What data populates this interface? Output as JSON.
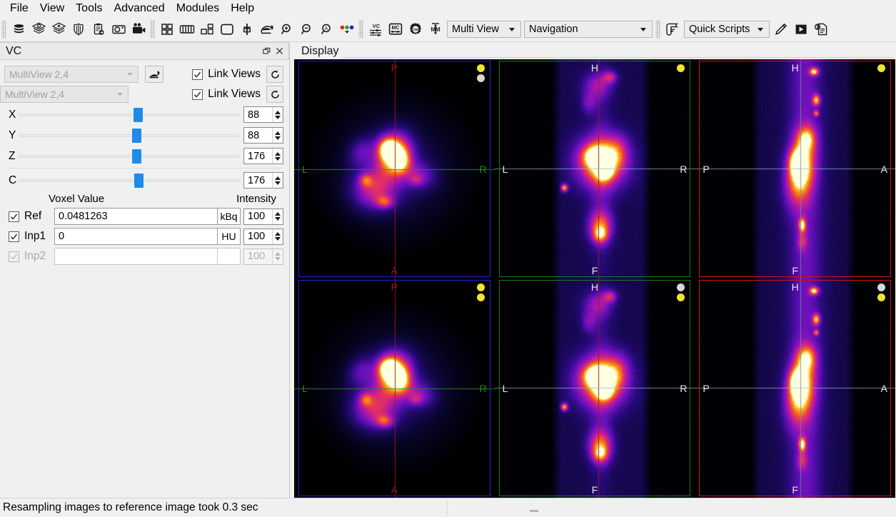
{
  "menubar": {
    "items": [
      {
        "label": "File"
      },
      {
        "label": "View"
      },
      {
        "label": "Tools"
      },
      {
        "label": "Advanced"
      },
      {
        "label": "Modules"
      },
      {
        "label": "Help"
      }
    ]
  },
  "toolbar": {
    "group1_icons": [
      "database-icon",
      "layers-one-icon",
      "layers-plus-icon",
      "shield-icon",
      "clipboard-export-icon",
      "camera-icon",
      "video-camera-icon"
    ],
    "group2_icons": [
      "grid-four-icon",
      "multi-slice-icon",
      "layout-mixed-icon",
      "single-view-icon",
      "fusion-icon",
      "pan-hand-icon",
      "zoom-in-icon",
      "zoom-out-icon",
      "zoom-region-icon",
      "rgb-channels-icon"
    ],
    "group3_icons": [
      "vc-icon",
      "mc-icon",
      "dm-icon",
      "mm-icon"
    ],
    "view_mode": {
      "value": "Multi View",
      "name": "view-mode-select"
    },
    "interaction_mode": {
      "value": "Navigation",
      "name": "interaction-mode-select"
    },
    "script_icon": "script-scroll-icon",
    "scripts": {
      "value": "Quick Scripts",
      "name": "quick-scripts-select"
    },
    "edit_script_icon": "pencil-icon",
    "run_script_icon": "play-icon",
    "script_log_icon": "script-document-icon"
  },
  "vc_panel": {
    "title": "VC",
    "float_icon": "float-window-icon",
    "close_icon": "close-icon",
    "combo1": {
      "value": "MultiView 2,4"
    },
    "combo2": {
      "value": "MultiView 2,4"
    },
    "blend_icon": "blend-layers-icon",
    "link1": {
      "label": "Link Views",
      "checked": true
    },
    "link2": {
      "label": "Link Views",
      "checked": true
    },
    "reset1_icon": "reset-circular-arrow-icon",
    "reset2_icon": "reset-circular-arrow-icon",
    "sliders": [
      {
        "label": "X",
        "value": "88",
        "pos_pct": 52
      },
      {
        "label": "Y",
        "value": "88",
        "pos_pct": 52
      },
      {
        "label": "Z",
        "value": "176",
        "pos_pct": 52
      },
      {
        "label": "C",
        "value": "176",
        "pos_pct": 52
      }
    ],
    "voxel_value_label": "Voxel Value",
    "intensity_label": "Intensity",
    "rows": [
      {
        "name": "ref",
        "label": "Ref",
        "checked": true,
        "enabled": true,
        "value": "0.0481263",
        "unit": "kBq",
        "intensity": "100"
      },
      {
        "name": "inp1",
        "label": "Inp1",
        "checked": true,
        "enabled": true,
        "value": "0",
        "unit": "HU",
        "intensity": "100"
      },
      {
        "name": "inp2",
        "label": "Inp2",
        "checked": true,
        "enabled": false,
        "value": "",
        "unit": "",
        "intensity": "100"
      }
    ]
  },
  "display": {
    "title": "Display",
    "viewports": [
      {
        "name": "axial-top",
        "frame_color": "blue",
        "plane": "axial",
        "labels": {
          "top": "P",
          "bottom": "A",
          "left": "L",
          "right": "R"
        },
        "label_color_v": "dark-red",
        "label_color_h": "green",
        "dots": [
          "yellow",
          "white"
        ]
      },
      {
        "name": "coronal-top",
        "frame_color": "green",
        "plane": "coronal",
        "labels": {
          "top": "H",
          "bottom": "F",
          "left": "L",
          "right": "R"
        },
        "label_color_v": "white",
        "label_color_h": "white",
        "dots": [
          "yellow"
        ]
      },
      {
        "name": "sagittal-top",
        "frame_color": "red",
        "plane": "sagittal",
        "labels": {
          "top": "H",
          "bottom": "F",
          "left": "P",
          "right": "A"
        },
        "label_color_v": "white",
        "label_color_h": "white",
        "dots": [
          "yellow"
        ]
      },
      {
        "name": "axial-bottom",
        "frame_color": "blue",
        "plane": "axial",
        "labels": {
          "top": "P",
          "bottom": "A",
          "left": "L",
          "right": "R"
        },
        "label_color_v": "dark-red",
        "label_color_h": "green",
        "dots": [
          "yellow",
          "yellow"
        ]
      },
      {
        "name": "coronal-bottom",
        "frame_color": "green",
        "plane": "coronal",
        "labels": {
          "top": "H",
          "bottom": "F",
          "left": "L",
          "right": "R"
        },
        "label_color_v": "white",
        "label_color_h": "white",
        "dots": [
          "white",
          "yellow"
        ]
      },
      {
        "name": "sagittal-bottom",
        "frame_color": "red",
        "plane": "sagittal",
        "labels": {
          "top": "H",
          "bottom": "F",
          "left": "P",
          "right": "A"
        },
        "label_color_v": "white",
        "label_color_h": "white",
        "dots": [
          "white",
          "yellow"
        ]
      }
    ]
  },
  "statusbar": {
    "message": "Resampling images to reference image took 0.3 sec"
  },
  "colors": {
    "accent_slider": "#1e8bea",
    "frame_blue": "#2222cc",
    "frame_green": "#1a7a1a",
    "frame_red": "#d21414",
    "dot_yellow": "#f2e531",
    "dot_white": "#d8d8d8",
    "window_bg": "#f0f0f0"
  }
}
